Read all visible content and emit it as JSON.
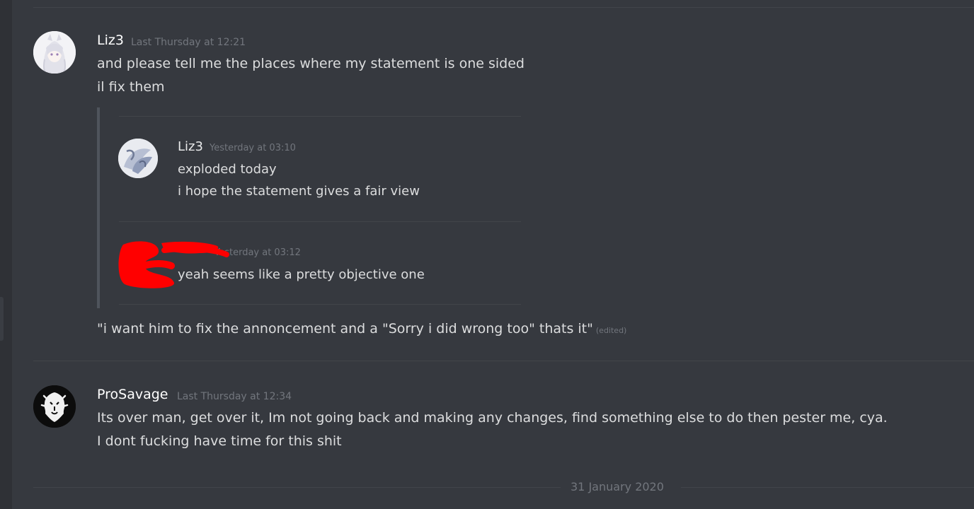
{
  "messages": [
    {
      "username": "Liz3",
      "timestamp": "Last Thursday at 12:21",
      "lines": [
        "and please tell me the places where my statement is one sided",
        "il fix them"
      ],
      "quoted": [
        {
          "username": "Liz3",
          "timestamp": "Yesterday at 03:10",
          "lines": [
            "exploded today",
            "i hope the statement gives a fair view"
          ]
        },
        {
          "username": "",
          "timestamp": "Yesterday at 03:12",
          "lines": [
            "yeah seems like a pretty objective one"
          ]
        }
      ],
      "after_text": "\"i want him to fix the annoncement and a \"Sorry i did wrong too\" thats it\"",
      "edited_label": "(edited)"
    },
    {
      "username": "ProSavage",
      "timestamp": "Last Thursday at 12:34",
      "lines": [
        "Its over man, get over it, Im not going back and making any changes, find something  else to do then pester me, cya.",
        "I dont fucking have time for this shit"
      ]
    }
  ],
  "date_divider": "31 January 2020",
  "colors": {
    "background": "#36393f",
    "username": "#ffffff",
    "text": "#dcddde",
    "muted": "#72767d",
    "redaction": "#ff0000"
  },
  "icons": {
    "liz3_avatar": "anime-girl-avatar",
    "prosavage_avatar": "lion-logo-avatar"
  }
}
